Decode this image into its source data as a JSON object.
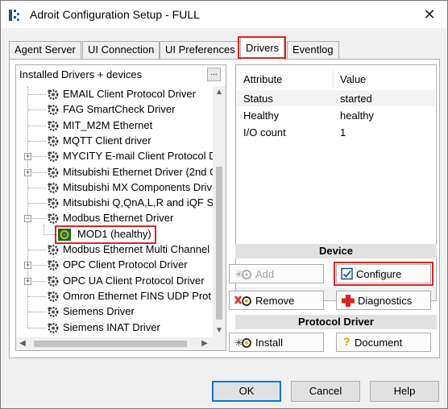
{
  "window": {
    "title": "Adroit Configuration Setup - FULL",
    "close_glyph": "✕"
  },
  "tabs": [
    {
      "label": "Agent Server"
    },
    {
      "label": "UI Connection"
    },
    {
      "label": "UI Preferences"
    },
    {
      "label": "Drivers",
      "selected": true
    },
    {
      "label": "Eventlog"
    }
  ],
  "tree": {
    "header": "Installed Drivers + devices",
    "header_button": "...",
    "items": [
      {
        "label": "EMAIL Client Protocol Driver",
        "expandable": false
      },
      {
        "label": "FAG SmartCheck Driver",
        "expandable": false
      },
      {
        "label": "MIT_M2M Ethernet",
        "expandable": false
      },
      {
        "label": "MQTT Client driver",
        "expandable": false
      },
      {
        "label": "MYCITY E-mail Client Protocol D",
        "expandable": true
      },
      {
        "label": "Mitsubishi Ethernet Driver (2nd G",
        "expandable": true
      },
      {
        "label": "Mitsubishi MX Components Driv",
        "expandable": false
      },
      {
        "label": "Mitsubishi Q,QnA,L,R and iQF S",
        "expandable": false
      },
      {
        "label": "Modbus Ethernet Driver",
        "expandable": true,
        "expanded": true
      },
      {
        "label": "MOD1 (healthy)",
        "child": true,
        "selected": true
      },
      {
        "label": "Modbus Ethernet Multi Channel",
        "expandable": false
      },
      {
        "label": "OPC Client Protocol Driver",
        "expandable": true
      },
      {
        "label": "OPC UA Client Protocol Driver",
        "expandable": true
      },
      {
        "label": "Omron Ethernet FINS UDP Prot",
        "expandable": false
      },
      {
        "label": "Siemens Driver",
        "expandable": false
      },
      {
        "label": "Siemens INAT Driver",
        "expandable": false
      }
    ]
  },
  "attributes": {
    "columns": [
      "Attribute",
      "Value"
    ],
    "rows": [
      {
        "attribute": "Status",
        "value": "started"
      },
      {
        "attribute": "Healthy",
        "value": "healthy"
      },
      {
        "attribute": "I/O count",
        "value": "1"
      }
    ]
  },
  "device_section": {
    "title": "Device",
    "add": "Add",
    "configure": "Configure",
    "remove": "Remove",
    "diagnostics": "Diagnostics"
  },
  "protocol_section": {
    "title": "Protocol Driver",
    "install": "Install",
    "document": "Document"
  },
  "dialog_buttons": {
    "ok": "OK",
    "cancel": "Cancel",
    "help": "Help"
  },
  "colors": {
    "highlight": "#d9261c",
    "selection": "#0078d7"
  }
}
